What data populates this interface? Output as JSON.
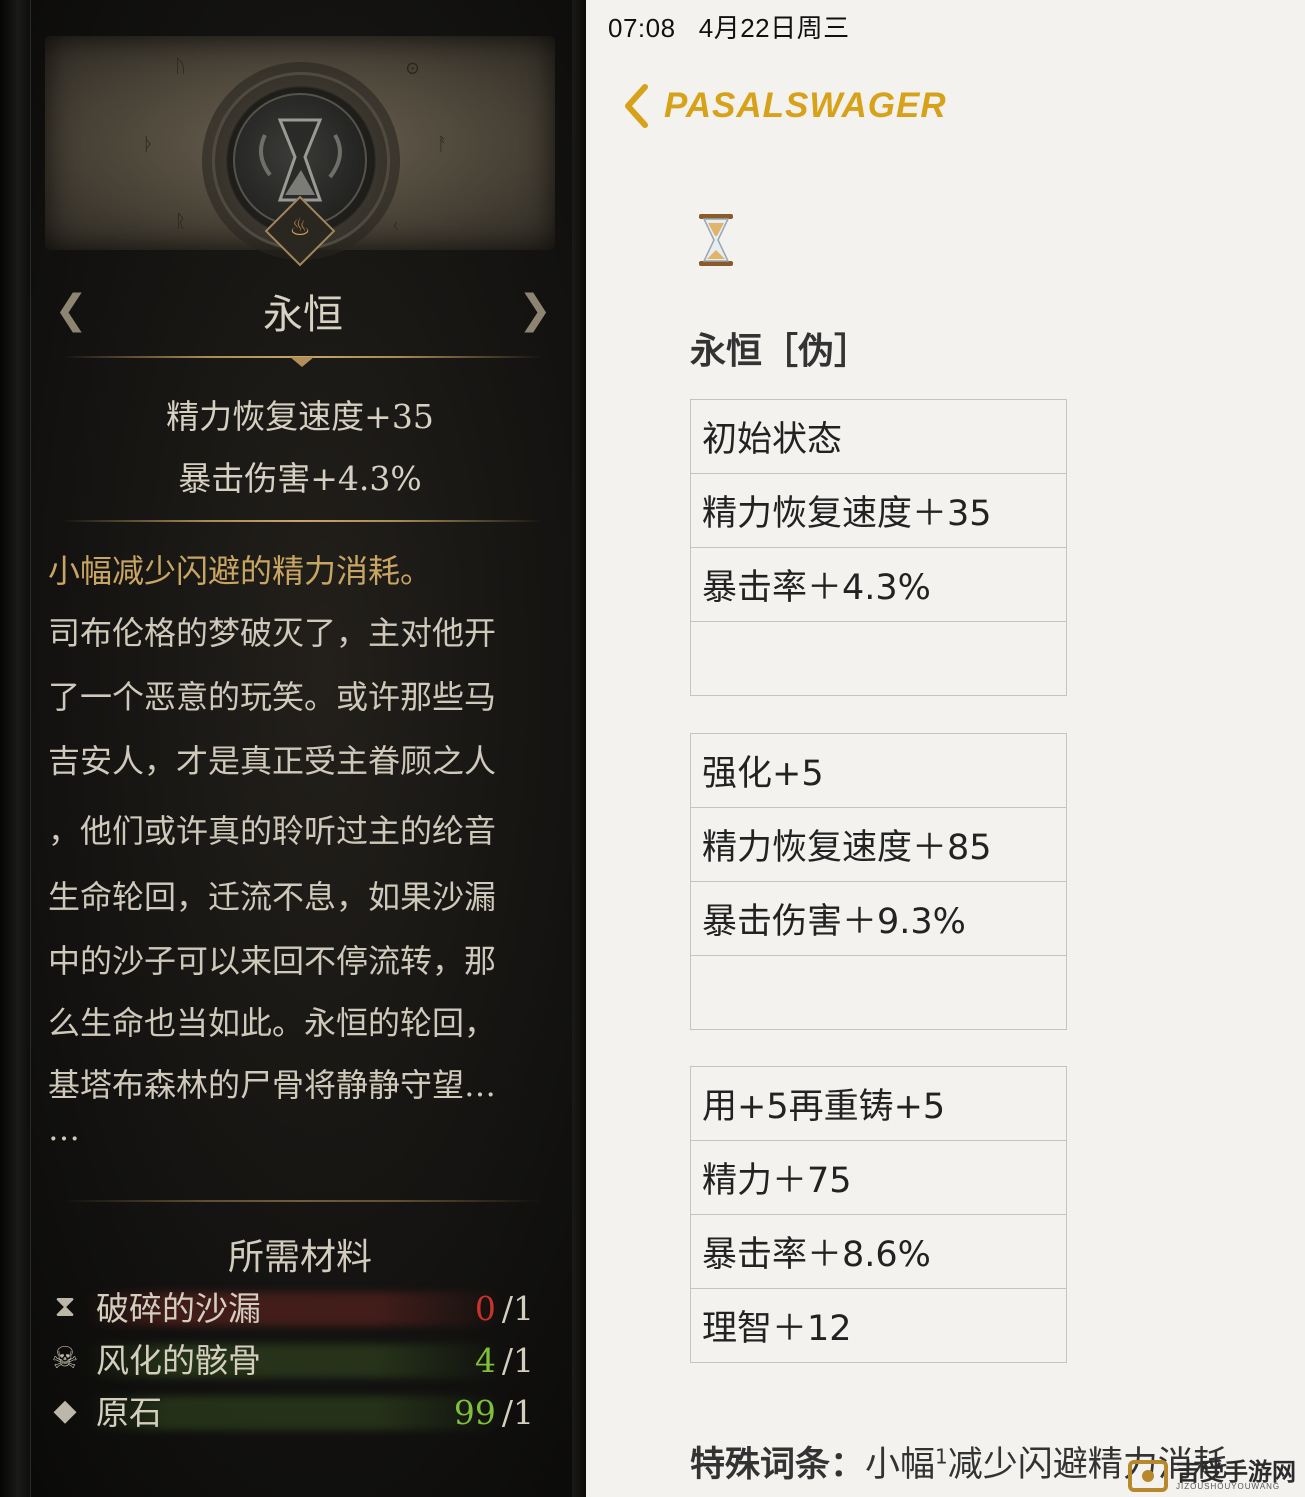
{
  "game_card": {
    "item_name": "永恒",
    "stats": [
      "精力恢复速度+35",
      "暴击伤害+4.3%"
    ],
    "effect": "小幅减少闪避的精力消耗。",
    "lore_lines": [
      "司布伦格的梦破灭了，主对他开",
      "了一个恶意的玩笑。或许那些马",
      "吉安人，才是真正受主眷顾之人",
      "，他们或许真的聆听过主的纶音",
      "生命轮回，迁流不息，如果沙漏",
      "中的沙子可以来回不停流转，那",
      "么生命也当如此。永恒的轮回，",
      "基塔布森林的尸骨将静静守望…",
      "…"
    ],
    "materials_title": "所需材料",
    "materials": [
      {
        "name": "破碎的沙漏",
        "have": "0",
        "need": "/1",
        "have_color": "#c8342c",
        "bar_color": "#7a2a26",
        "icon": "broken-hourglass-icon"
      },
      {
        "name": "风化的骸骨",
        "have": "4",
        "need": "/1",
        "have_color": "#7fbf3a",
        "bar_color": "#3d5a26",
        "icon": "bone-pile-icon"
      },
      {
        "name": "原石",
        "have": "99",
        "need": "/1",
        "have_color": "#7fbf3a",
        "bar_color": "#3d5a26",
        "icon": "raw-stone-icon"
      }
    ]
  },
  "notes": {
    "status_bar": {
      "time": "07:08",
      "date": "4月22日周三"
    },
    "back_label": "PASALSWAGER",
    "accent_color": "#d7a21a",
    "emoji": "⌛",
    "title": "永恒［伪］",
    "tables": [
      {
        "rows": [
          "初始状态",
          "精力恢复速度＋35",
          "暴击率＋4.3%",
          ""
        ]
      },
      {
        "rows": [
          "强化+5",
          "精力恢复速度＋85",
          "暴击伤害＋9.3%",
          ""
        ]
      },
      {
        "rows": [
          "用+5再重铸+5",
          "精力＋75",
          "暴击率＋8.6%",
          "理智＋12"
        ]
      }
    ],
    "special_label": "特殊词条：",
    "special_text_a": "小幅",
    "special_sup": "1",
    "special_text_b": "减少闪避精力消耗"
  },
  "watermark": {
    "text": "吉受手游网",
    "sub": "JIZOUSHOUYOUWANG"
  }
}
